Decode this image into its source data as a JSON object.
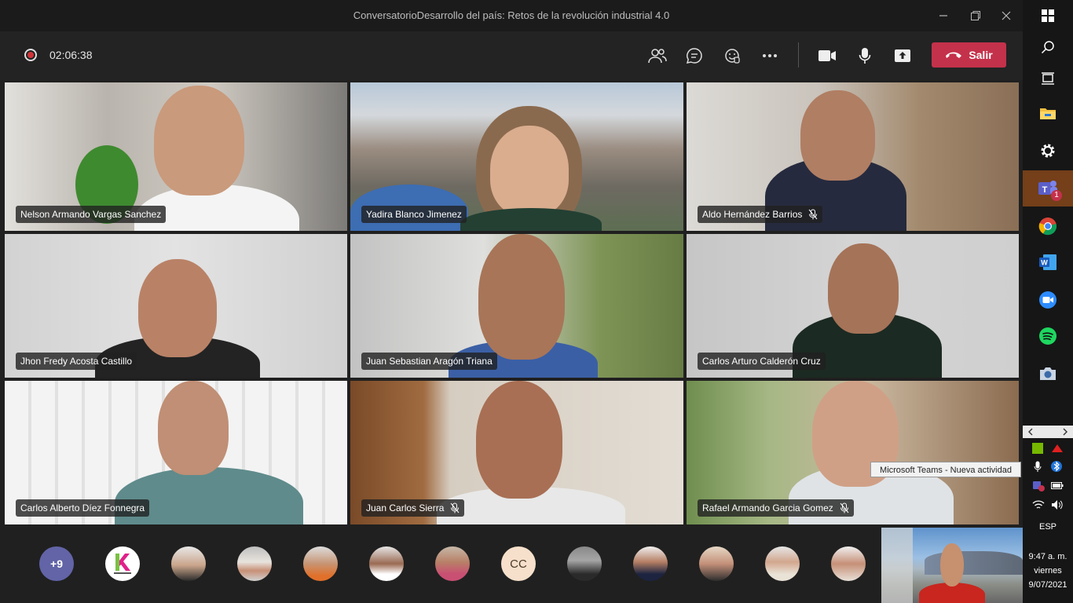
{
  "window": {
    "title": "ConversatorioDesarrollo del país: Retos de la revolución industrial 4.0"
  },
  "call": {
    "timer": "02:06:38",
    "leave_label": "Salir"
  },
  "participants": [
    {
      "name": "Nelson Armando Vargas Sanchez",
      "muted": false
    },
    {
      "name": "Yadira Blanco Jimenez",
      "muted": false
    },
    {
      "name": "Aldo Hernández Barrios",
      "muted": true
    },
    {
      "name": "Jhon Fredy Acosta Castillo",
      "muted": false
    },
    {
      "name": "Juan Sebastian Aragón Triana",
      "muted": false
    },
    {
      "name": "Carlos Arturo Calderón Cruz",
      "muted": false
    },
    {
      "name": "Carlos Alberto Díez Fonnegra",
      "muted": false
    },
    {
      "name": "Juan Carlos Sierra",
      "muted": true
    },
    {
      "name": "Rafael Armando Garcia Gomez",
      "muted": true
    }
  ],
  "strip": {
    "more_count": "+9",
    "initials_avatar": "CC"
  },
  "colors": {
    "leave": "#c4314b",
    "more_badge": "#6264a7",
    "recording": "#d13438"
  },
  "notification": {
    "text": "Microsoft Teams - Nueva actividad"
  },
  "taskbar": {
    "language": "ESP",
    "time": "9:47 a. m.",
    "day": "viernes",
    "date": "9/07/2021",
    "teams_badge": "1"
  }
}
